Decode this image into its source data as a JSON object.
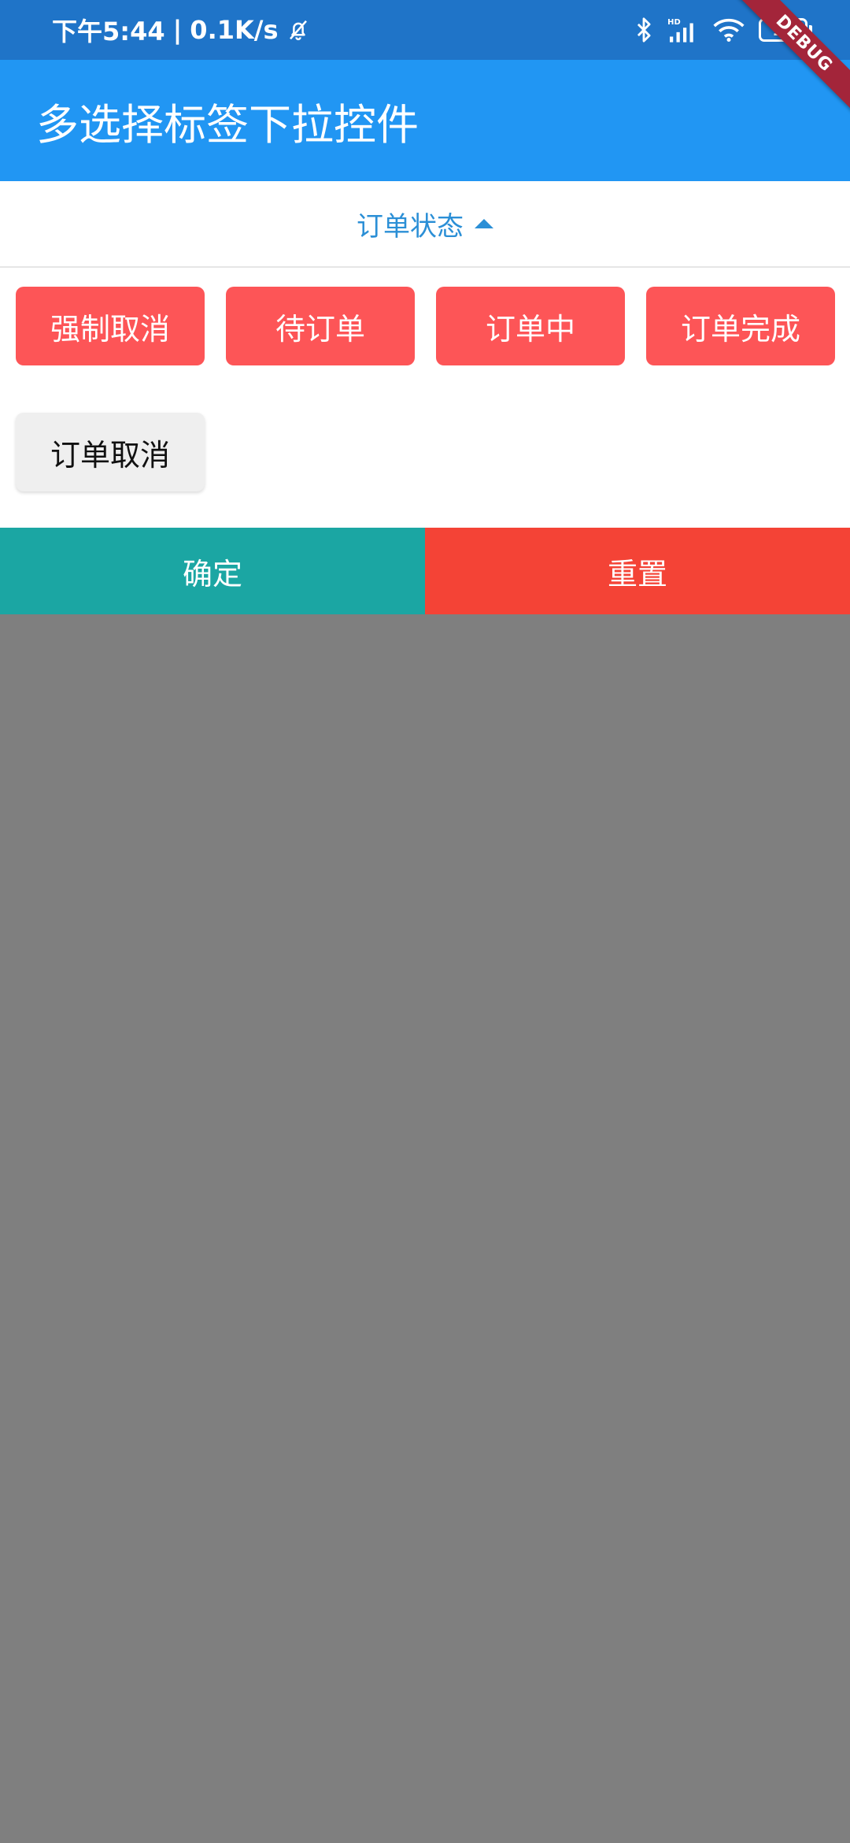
{
  "status_bar": {
    "time": "下午5:44",
    "separator": "|",
    "net_speed": "0.1K/s",
    "battery_level": "11",
    "icons": [
      "mute-bell-icon",
      "bluetooth-icon",
      "hd-signal-icon",
      "wifi-icon",
      "battery-icon"
    ]
  },
  "debug_banner": "DEBUG",
  "app_bar": {
    "title": "多选择标签下拉控件"
  },
  "dropdown": {
    "label": "订单状态",
    "icon": "caret-up-icon",
    "accent": "#2b8fd6"
  },
  "tags": [
    {
      "label": "强制取消",
      "selected": true
    },
    {
      "label": "待订单",
      "selected": true
    },
    {
      "label": "订单中",
      "selected": true
    },
    {
      "label": "订单完成",
      "selected": true
    },
    {
      "label": "订单取消",
      "selected": false
    }
  ],
  "actions": {
    "confirm_label": "确定",
    "reset_label": "重置"
  },
  "colors": {
    "status_bar": "#1f74c8",
    "app_bar": "#2196f3",
    "tag_selected": "#fd5557",
    "tag_unselected": "#efefef",
    "confirm": "#1ba6a3",
    "reset": "#f44336",
    "overlay": "#7f7f7f"
  }
}
